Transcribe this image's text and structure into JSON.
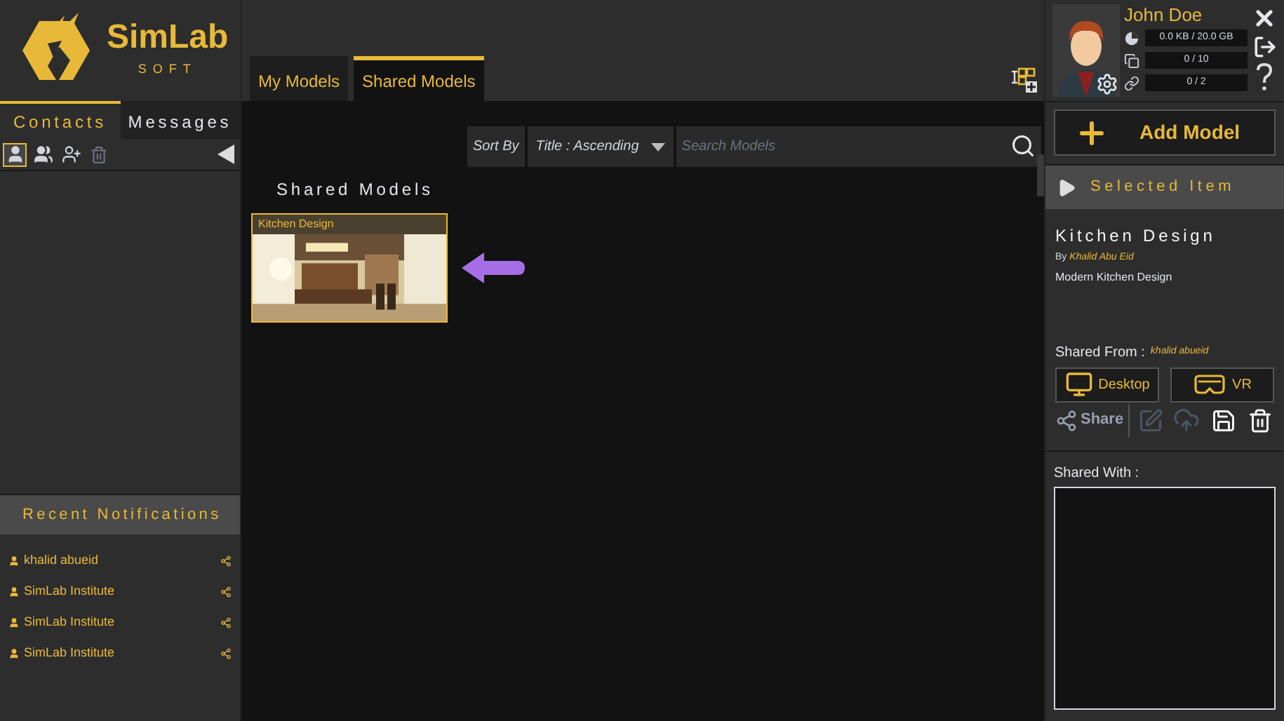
{
  "logo": {
    "name": "SimLab",
    "sub": "SOFT"
  },
  "left_tabs": [
    {
      "label": "Contacts",
      "selected": true
    },
    {
      "label": "Messages",
      "selected": false
    }
  ],
  "contact_tools": [
    {
      "kind": "user",
      "selected": true
    },
    {
      "kind": "group",
      "selected": false
    },
    {
      "kind": "add-user",
      "selected": false
    },
    {
      "kind": "delete",
      "selected": false
    }
  ],
  "notifications": {
    "title": "Recent Notifications",
    "items": [
      {
        "name": "khalid abueid"
      },
      {
        "name": "SimLab Institute"
      },
      {
        "name": "SimLab Institute"
      },
      {
        "name": "SimLab Institute"
      }
    ]
  },
  "tabs": [
    {
      "label": "My Models",
      "selected": false
    },
    {
      "label": "Shared Models",
      "selected": true
    }
  ],
  "sort": {
    "label": "Sort By",
    "value": "Title : Ascending"
  },
  "search": {
    "placeholder": "Search Models"
  },
  "section_title": "Shared Models",
  "models": [
    {
      "title": "Kitchen Design",
      "selected": true
    }
  ],
  "user": {
    "name": "John Doe",
    "stats": [
      {
        "kind": "storage",
        "value": "0.0 KB / 20.0 GB"
      },
      {
        "kind": "models",
        "value": "0 / 10"
      },
      {
        "kind": "links",
        "value": "0 / 2"
      }
    ]
  },
  "add_model": "Add Model",
  "selected_item": {
    "header": "Selected Item",
    "title": "Kitchen Design",
    "by": "By",
    "author": "Khalid Abu Eid",
    "description": "Modern Kitchen Design",
    "shared_from_label": "Shared From :",
    "shared_from": "khalid abueid"
  },
  "view_buttons": [
    {
      "kind": "desktop",
      "label": "Desktop"
    },
    {
      "kind": "vr",
      "label": "VR"
    }
  ],
  "share_label": "Share",
  "actions": [
    {
      "kind": "edit",
      "disabled": true
    },
    {
      "kind": "upload",
      "disabled": true
    },
    {
      "kind": "save",
      "disabled": false
    },
    {
      "kind": "delete",
      "disabled": false
    }
  ],
  "shared_with_label": "Shared With :"
}
